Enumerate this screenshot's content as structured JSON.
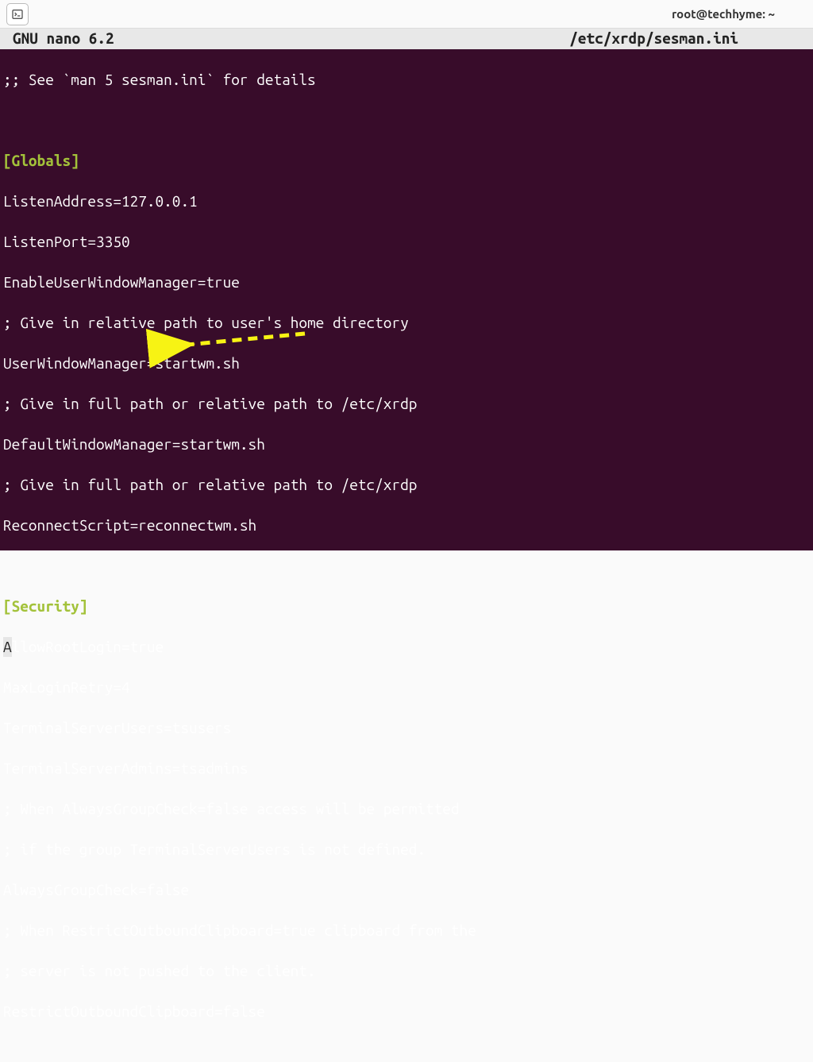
{
  "window": {
    "title": "root@techhyme: ~"
  },
  "editor": {
    "app_name": "GNU nano 6.2",
    "file_path": "/etc/xrdp/sesman.ini"
  },
  "content": {
    "comment_top": ";; See `man 5 sesman.ini` for details",
    "section_globals": "[Globals]",
    "globals_lines": [
      "ListenAddress=127.0.0.1",
      "ListenPort=3350",
      "EnableUserWindowManager=true",
      "; Give in relative path to user's home directory",
      "UserWindowManager=startwm.sh",
      "; Give in full path or relative path to /etc/xrdp",
      "DefaultWindowManager=startwm.sh",
      "; Give in full path or relative path to /etc/xrdp",
      "ReconnectScript=reconnectwm.sh"
    ],
    "section_security": "[Security]",
    "security_cursor_char": "A",
    "security_line1_rest": "llowRootLogin=true",
    "security_lines": [
      "MaxLoginRetry=4",
      "TerminalServerUsers=tsusers",
      "TerminalServerAdmins=tsadmins",
      "; When AlwaysGroupCheck=false access will be permitted",
      "; if the group TerminalServerUsers is not defined.",
      "AlwaysGroupCheck=false",
      "; When RestrictOutboundClipboard=true clipboard from the",
      "; server is not pushed to the client.",
      "RestrictOutboundClipboard=false"
    ]
  }
}
